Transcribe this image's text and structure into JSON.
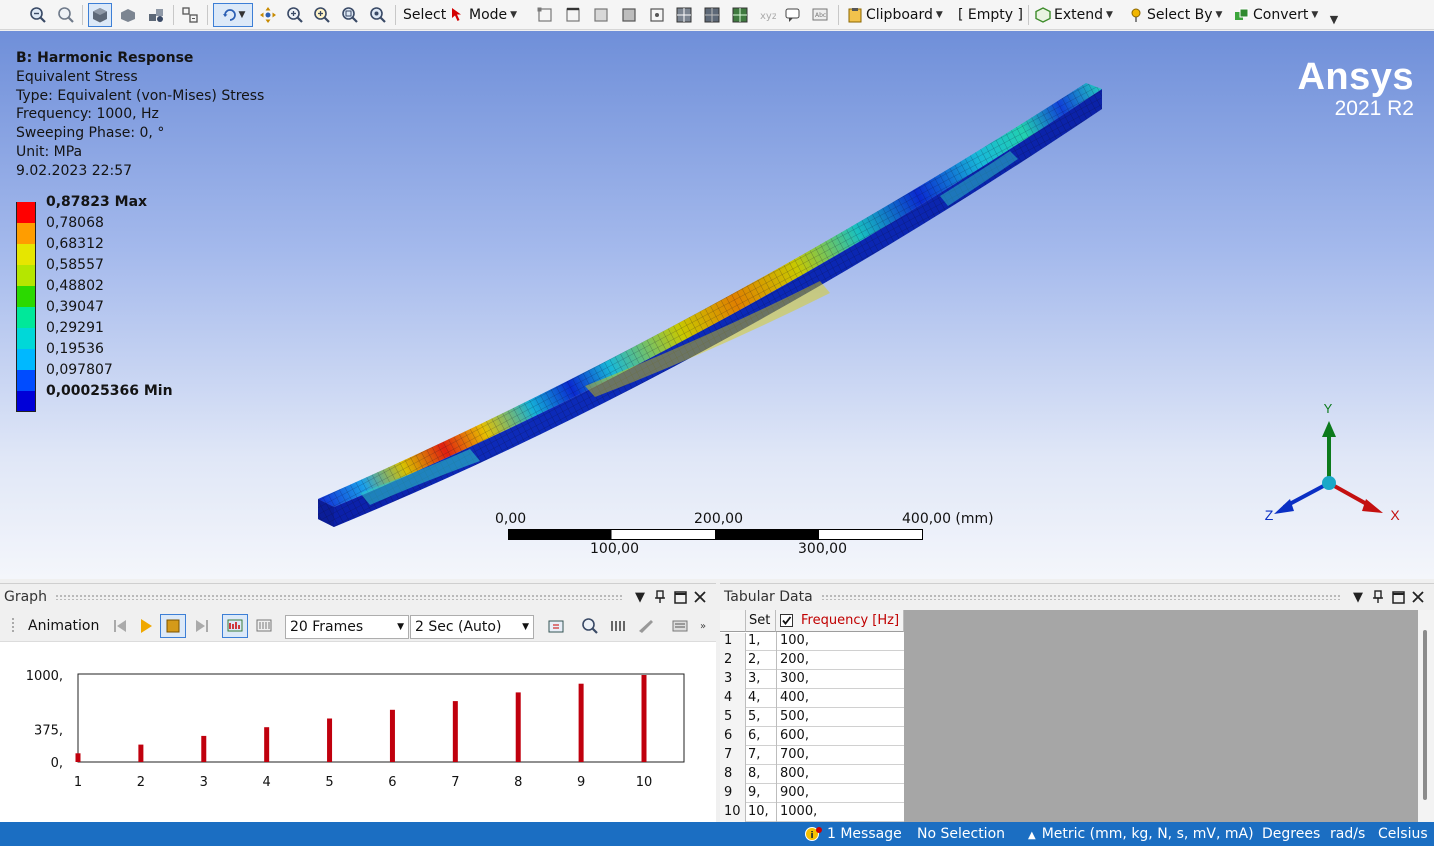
{
  "toolbar": {
    "select_label": "Select",
    "mode_label": "Mode",
    "clipboard_label": "Clipboard",
    "empty_label": "[ Empty ]",
    "extend_label": "Extend",
    "select_by_label": "Select By",
    "convert_label": "Convert"
  },
  "viewport": {
    "title": "B: Harmonic Response",
    "result_name": "Equivalent Stress",
    "type": "Type: Equivalent (von-Mises) Stress",
    "frequency": "Frequency: 1000, Hz",
    "phase": "Sweeping Phase: 0, °",
    "unit": "Unit: MPa",
    "timestamp": "9.02.2023 22:57",
    "legend": {
      "colors": [
        "#ff0000",
        "#ff9d00",
        "#e6e600",
        "#b5e600",
        "#2bd900",
        "#00e89a",
        "#00d8d8",
        "#00b8ff",
        "#004cff",
        "#0000d8"
      ],
      "labels": [
        "0,87823 Max",
        "0,78068",
        "0,68312",
        "0,58557",
        "0,48802",
        "0,39047",
        "0,29291",
        "0,19536",
        "0,097807",
        "0,00025366 Min"
      ]
    },
    "brand": {
      "name": "Ansys",
      "version": "2021 R2"
    },
    "scale": {
      "top": [
        "0,00",
        "200,00",
        "400,00 (mm)"
      ],
      "bottom": [
        "100,00",
        "300,00"
      ]
    },
    "triad": {
      "y": "Y",
      "z": "Z",
      "x": "X"
    }
  },
  "graph": {
    "title": "Graph",
    "animation_label": "Animation",
    "frames": "20 Frames",
    "duration": "2 Sec (Auto)"
  },
  "chart_data": {
    "type": "bar",
    "categories": [
      "1",
      "2",
      "3",
      "4",
      "5",
      "6",
      "7",
      "8",
      "9",
      "10"
    ],
    "values": [
      100,
      200,
      300,
      400,
      500,
      600,
      700,
      800,
      900,
      1000
    ],
    "yticks": [
      "0,",
      "375,",
      "1000,"
    ],
    "ylim": [
      0,
      1000
    ],
    "bar_color": "#c0000d",
    "xlabel": "",
    "ylabel": ""
  },
  "tabular": {
    "title": "Tabular Data",
    "col_set": "Set",
    "col_freq": "Frequency [Hz]",
    "rows": [
      {
        "n": "1",
        "set": "1,",
        "freq": "100,"
      },
      {
        "n": "2",
        "set": "2,",
        "freq": "200,"
      },
      {
        "n": "3",
        "set": "3,",
        "freq": "300,"
      },
      {
        "n": "4",
        "set": "4,",
        "freq": "400,"
      },
      {
        "n": "5",
        "set": "5,",
        "freq": "500,"
      },
      {
        "n": "6",
        "set": "6,",
        "freq": "600,"
      },
      {
        "n": "7",
        "set": "7,",
        "freq": "700,"
      },
      {
        "n": "8",
        "set": "8,",
        "freq": "800,"
      },
      {
        "n": "9",
        "set": "9,",
        "freq": "900,"
      },
      {
        "n": "10",
        "set": "10,",
        "freq": "1000,"
      }
    ]
  },
  "status": {
    "messages": "1 Message",
    "selection": "No Selection",
    "units": "Metric (mm, kg, N, s, mV, mA)",
    "angle": "Degrees",
    "rotational": "rad/s",
    "temperature": "Celsius"
  }
}
